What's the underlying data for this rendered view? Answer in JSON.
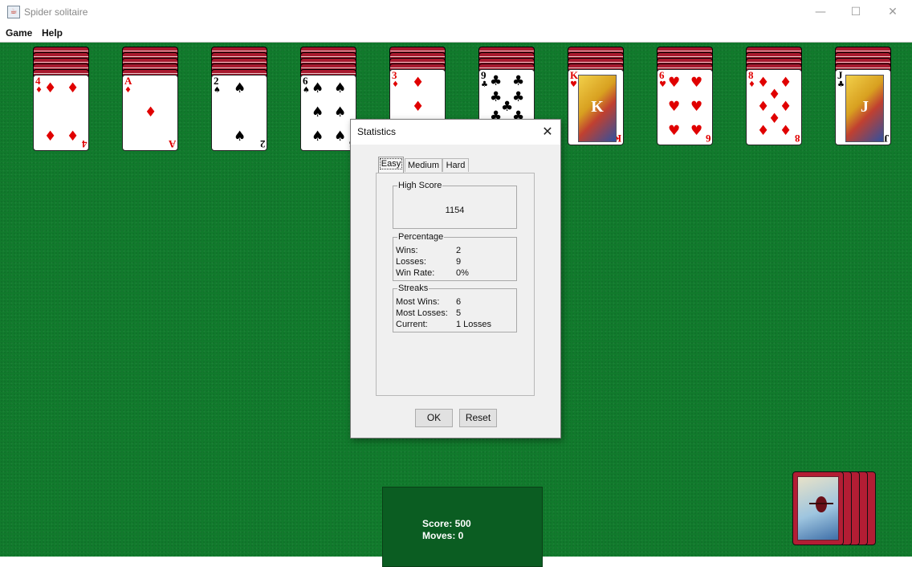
{
  "window": {
    "title": "Spider solitaire",
    "icon": "java-cup-icon",
    "controls": [
      "minimize-icon",
      "maximize-icon",
      "close-icon"
    ]
  },
  "menu": {
    "items": [
      "Game",
      "Help"
    ]
  },
  "tableau": {
    "background_color": "#117a2c",
    "columns": [
      {
        "face_down_count": 5,
        "top_card": {
          "rank": "4",
          "suit": "♦",
          "color": "red"
        }
      },
      {
        "face_down_count": 5,
        "top_card": {
          "rank": "A",
          "suit": "♦",
          "color": "red"
        }
      },
      {
        "face_down_count": 5,
        "top_card": {
          "rank": "2",
          "suit": "♠",
          "color": "black"
        }
      },
      {
        "face_down_count": 5,
        "top_card": {
          "rank": "6",
          "suit": "♠",
          "color": "black"
        }
      },
      {
        "face_down_count": 4,
        "top_card": {
          "rank": "3",
          "suit": "♦",
          "color": "red"
        }
      },
      {
        "face_down_count": 4,
        "top_card": {
          "rank": "9",
          "suit": "♣",
          "color": "black"
        }
      },
      {
        "face_down_count": 4,
        "top_card": {
          "rank": "K",
          "suit": "♥",
          "color": "red"
        }
      },
      {
        "face_down_count": 4,
        "top_card": {
          "rank": "6",
          "suit": "♥",
          "color": "red"
        }
      },
      {
        "face_down_count": 4,
        "top_card": {
          "rank": "8",
          "suit": "♦",
          "color": "red"
        }
      },
      {
        "face_down_count": 4,
        "top_card": {
          "rank": "J",
          "suit": "♣",
          "color": "black"
        }
      }
    ]
  },
  "score_panel": {
    "score_text": "Score: 500",
    "moves_text": "Moves: 0"
  },
  "stock": {
    "piles": 5,
    "art": "spider-web-icon"
  },
  "statistics_dialog": {
    "title": "Statistics",
    "tabs": [
      "Easy",
      "Medium",
      "Hard"
    ],
    "active_tab": "Easy",
    "high_score": {
      "title": "High Score",
      "value": "1154"
    },
    "percentage": {
      "title": "Percentage",
      "rows": [
        {
          "label": "Wins:",
          "value": "2"
        },
        {
          "label": "Losses:",
          "value": "9"
        },
        {
          "label": "Win Rate:",
          "value": "0%"
        }
      ]
    },
    "streaks": {
      "title": "Streaks",
      "rows": [
        {
          "label": "Most Wins:",
          "value": "6"
        },
        {
          "label": "Most Losses:",
          "value": "5"
        },
        {
          "label": "Current:",
          "value": "1 Losses"
        }
      ]
    },
    "buttons": {
      "ok": "OK",
      "reset": "Reset"
    }
  }
}
